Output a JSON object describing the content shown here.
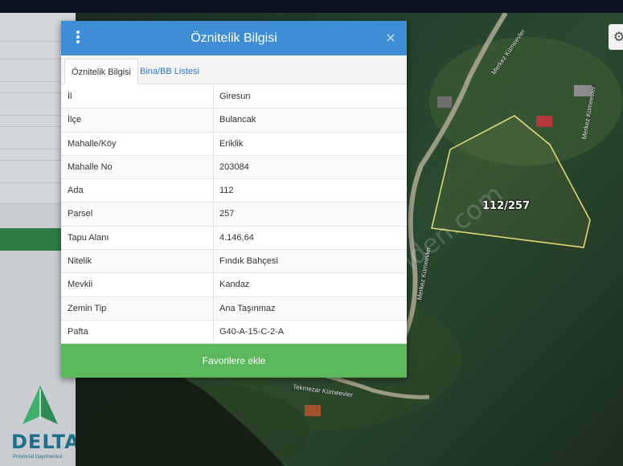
{
  "modal": {
    "title": "Öznitelik Bilgisi",
    "close_label": "×",
    "tabs": [
      {
        "label": "Öznitelik Bilgisi",
        "active": true
      },
      {
        "label": "Bina/BB Listesi",
        "active": false
      }
    ],
    "rows": [
      {
        "key": "İl",
        "value": "Giresun"
      },
      {
        "key": "İlçe",
        "value": "Bulancak"
      },
      {
        "key": "Mahalle/Köy",
        "value": "Eriklik"
      },
      {
        "key": "Mahalle No",
        "value": "203084"
      },
      {
        "key": "Ada",
        "value": "112"
      },
      {
        "key": "Parsel",
        "value": "257"
      },
      {
        "key": "Tapu Alanı",
        "value": "4.146,64"
      },
      {
        "key": "Nitelik",
        "value": "Fındık Bahçesi"
      },
      {
        "key": "Mevkii",
        "value": "Kandaz"
      },
      {
        "key": "Zemin Tip",
        "value": "Ana Taşınmaz"
      },
      {
        "key": "Pafta",
        "value": "G40-A-15-C-2-A"
      }
    ],
    "favorite_button": "Favorilere ekle"
  },
  "map": {
    "parcel_label": "112/257",
    "road_labels": [
      "Merkez Kümeevler",
      "Merkez Kümeevler",
      "Merkez Kümeevler",
      "Tekmezar Kümeevler"
    ],
    "watermark": "sahibinden.com",
    "gear_icon": "gear-icon"
  },
  "logo": {
    "name": "DELTA",
    "subtitle": "Provincial Gayrimenkul"
  },
  "colors": {
    "header": "#3e8dd5",
    "button": "#5cb85c",
    "parcel_outline": "#e8e07a"
  }
}
